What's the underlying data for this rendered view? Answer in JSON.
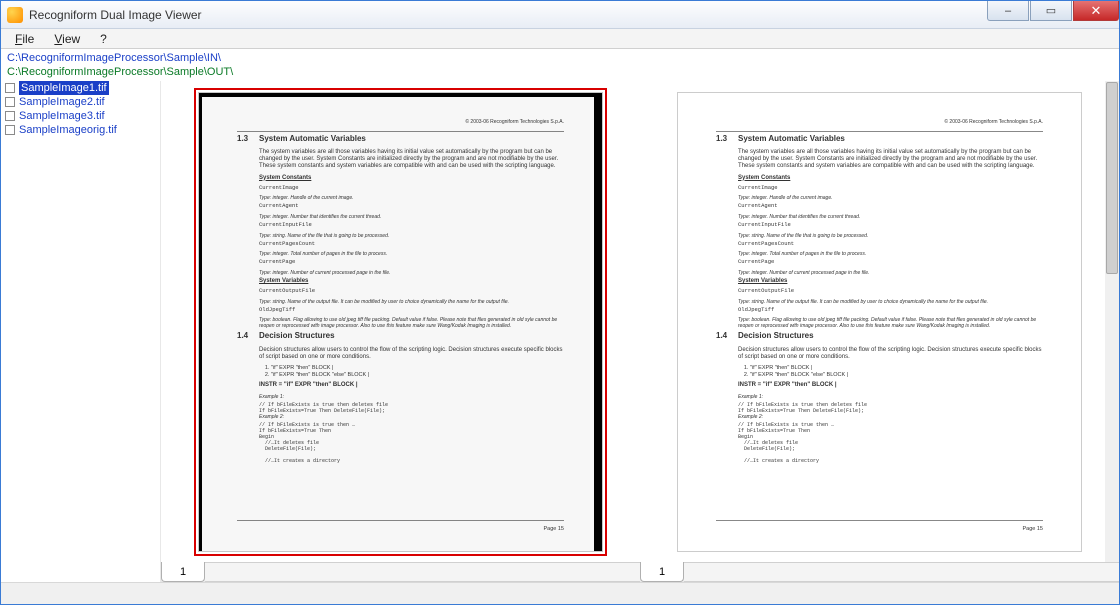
{
  "window": {
    "title": "Recogniform Dual Image Viewer"
  },
  "win_controls": {
    "min": "–",
    "max": "▭",
    "close": "✕"
  },
  "menubar": {
    "file": "File",
    "view": "View",
    "help": "?"
  },
  "paths": {
    "in": "C:\\RecogniformImageProcessor\\Sample\\IN\\",
    "out": "C:\\RecogniformImageProcessor\\Sample\\OUT\\"
  },
  "sidebar": {
    "items": [
      {
        "name": "SampleImage1.tif",
        "selected": true
      },
      {
        "name": "SampleImage2.tif",
        "selected": false
      },
      {
        "name": "SampleImage3.tif",
        "selected": false
      },
      {
        "name": "SampleImageorig.tif",
        "selected": false
      }
    ]
  },
  "doc": {
    "copyright": "© 2003-06 Recogniform Technologies S.p.A.",
    "page_number": "Page 15",
    "sec1_num": "1.3",
    "sec1_title": "System Automatic Variables",
    "sec1_para": "The system variables are all those variables having its initial value set automatically by the program but can be changed by the user.  System Constants are initialized directly by the program and are not modifiable by the user.  These system constants and system variables are compatible with and can be used with the scripting language.",
    "sys_const": "System Constants",
    "ci_name": "CurrentImage",
    "ci_desc": "Type: integer. Handle of the current image.",
    "ca_name": "CurrentAgent",
    "ca_desc": "Type: integer. Number that identifies the current thread.",
    "cif_name": "CurrentInputFile",
    "cif_desc": "Type: string. Name of the file that is going to be  processed.",
    "cpc_name": "CurrentPagesCount",
    "cpc_desc": "Type: integer. Total number of pages in the file to process.",
    "cp_name": "CurrentPage",
    "cp_desc": "Type: integer. Number of current processed page in the file.",
    "sys_var": "System Variables",
    "cof_name": "CurrentOutputFile",
    "cof_desc": "Type: string. Name of the output file. It can be modified by user to choice dynamically the name for the output file.",
    "ojt_name": "OldJpegTiff",
    "ojt_desc": "Type: boolean. Flag allowing to use old jpeg tiff file packing. Default value if false. Please note that files generated in old syle cannot be reopen or reprocessed with image processor. Also to use this feature make sure Wang/Kodak Imaging is installed.",
    "sec2_num": "1.4",
    "sec2_title": "Decision Structures",
    "sec2_para": "Decision structures allow users to control the flow of the scripting logic.  Decision structures execute specific blocks of script based on one or more conditions.",
    "ds_li1": "\"if\" EXPR \"then\" BLOCK |",
    "ds_li2": "\"if\" EXPR \"then\" BLOCK \"else\" BLOCK |",
    "instr": "INSTR = \"if\" EXPR \"then\" BLOCK |",
    "ex1": "Example 1:",
    "ex1_code": "// If bFileExists is true then deletes file\nIf bFileExists=True Then DeleteFile(File);",
    "ex2": "Example 2:",
    "ex2_code": "// If bFileExists is true then …\nIf bFileExists=True Then\nBegin\n  //…It deletes file\n  DeleteFile(File);\n\n  //…It creates a directory"
  },
  "tabs": {
    "left": "1",
    "right": "1"
  }
}
